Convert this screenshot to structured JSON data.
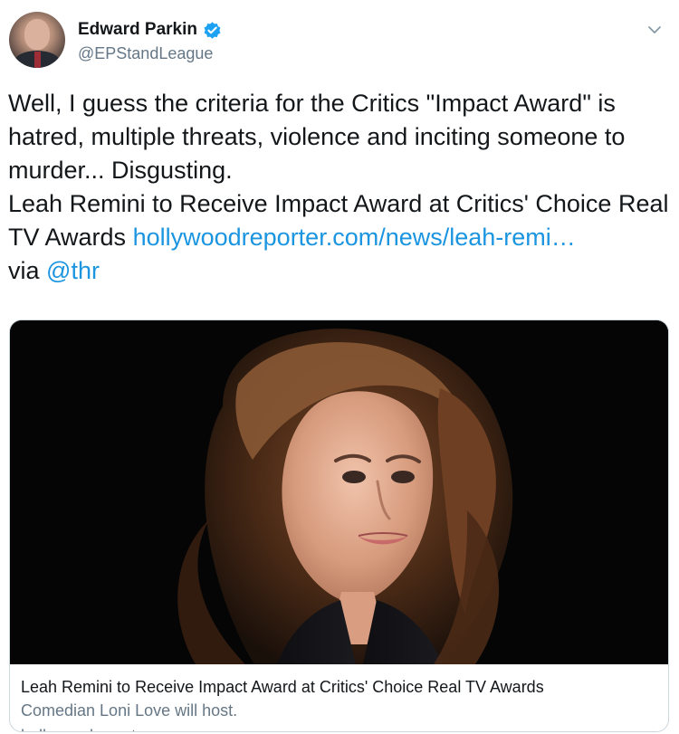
{
  "author": {
    "name": "Edward Parkin",
    "handle": "@EPStandLeague",
    "verified": true
  },
  "tweet": {
    "line1": "Well, I guess the criteria for the Critics \"Impact Award\" is hatred, multiple threats, violence and inciting someone to murder... Disgusting.",
    "line2": "Leah Remini to Receive Impact Award at Critics' Choice Real TV Awards",
    "link": "hollywoodreporter.com/news/leah-remi…",
    "via": "via",
    "mention": "@thr"
  },
  "card": {
    "title": "Leah Remini to Receive Impact Award at Critics' Choice Real TV Awards",
    "description": "Comedian Loni Love will host.",
    "domain": "hollywoodreporter.com"
  },
  "colors": {
    "link": "#1b95e0",
    "verified": "#1da1f2",
    "secondary_text": "#657786",
    "border": "#ccd6dd"
  },
  "icons": {
    "verified": "verified-badge-icon",
    "menu": "chevron-down-icon"
  }
}
